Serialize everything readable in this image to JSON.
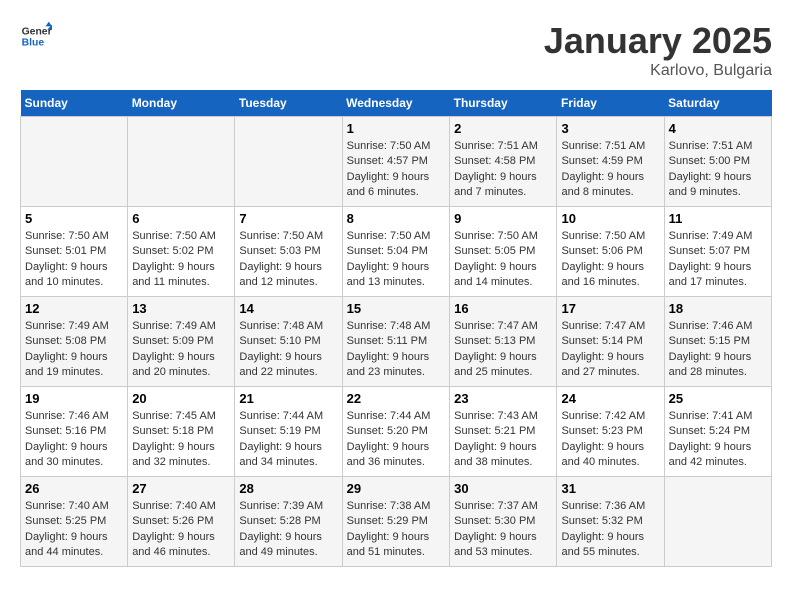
{
  "logo": {
    "general": "General",
    "blue": "Blue"
  },
  "header": {
    "month": "January 2025",
    "location": "Karlovo, Bulgaria"
  },
  "days_of_week": [
    "Sunday",
    "Monday",
    "Tuesday",
    "Wednesday",
    "Thursday",
    "Friday",
    "Saturday"
  ],
  "weeks": [
    [
      {
        "day": "",
        "info": ""
      },
      {
        "day": "",
        "info": ""
      },
      {
        "day": "",
        "info": ""
      },
      {
        "day": "1",
        "info": "Sunrise: 7:50 AM\nSunset: 4:57 PM\nDaylight: 9 hours and 6 minutes."
      },
      {
        "day": "2",
        "info": "Sunrise: 7:51 AM\nSunset: 4:58 PM\nDaylight: 9 hours and 7 minutes."
      },
      {
        "day": "3",
        "info": "Sunrise: 7:51 AM\nSunset: 4:59 PM\nDaylight: 9 hours and 8 minutes."
      },
      {
        "day": "4",
        "info": "Sunrise: 7:51 AM\nSunset: 5:00 PM\nDaylight: 9 hours and 9 minutes."
      }
    ],
    [
      {
        "day": "5",
        "info": "Sunrise: 7:50 AM\nSunset: 5:01 PM\nDaylight: 9 hours and 10 minutes."
      },
      {
        "day": "6",
        "info": "Sunrise: 7:50 AM\nSunset: 5:02 PM\nDaylight: 9 hours and 11 minutes."
      },
      {
        "day": "7",
        "info": "Sunrise: 7:50 AM\nSunset: 5:03 PM\nDaylight: 9 hours and 12 minutes."
      },
      {
        "day": "8",
        "info": "Sunrise: 7:50 AM\nSunset: 5:04 PM\nDaylight: 9 hours and 13 minutes."
      },
      {
        "day": "9",
        "info": "Sunrise: 7:50 AM\nSunset: 5:05 PM\nDaylight: 9 hours and 14 minutes."
      },
      {
        "day": "10",
        "info": "Sunrise: 7:50 AM\nSunset: 5:06 PM\nDaylight: 9 hours and 16 minutes."
      },
      {
        "day": "11",
        "info": "Sunrise: 7:49 AM\nSunset: 5:07 PM\nDaylight: 9 hours and 17 minutes."
      }
    ],
    [
      {
        "day": "12",
        "info": "Sunrise: 7:49 AM\nSunset: 5:08 PM\nDaylight: 9 hours and 19 minutes."
      },
      {
        "day": "13",
        "info": "Sunrise: 7:49 AM\nSunset: 5:09 PM\nDaylight: 9 hours and 20 minutes."
      },
      {
        "day": "14",
        "info": "Sunrise: 7:48 AM\nSunset: 5:10 PM\nDaylight: 9 hours and 22 minutes."
      },
      {
        "day": "15",
        "info": "Sunrise: 7:48 AM\nSunset: 5:11 PM\nDaylight: 9 hours and 23 minutes."
      },
      {
        "day": "16",
        "info": "Sunrise: 7:47 AM\nSunset: 5:13 PM\nDaylight: 9 hours and 25 minutes."
      },
      {
        "day": "17",
        "info": "Sunrise: 7:47 AM\nSunset: 5:14 PM\nDaylight: 9 hours and 27 minutes."
      },
      {
        "day": "18",
        "info": "Sunrise: 7:46 AM\nSunset: 5:15 PM\nDaylight: 9 hours and 28 minutes."
      }
    ],
    [
      {
        "day": "19",
        "info": "Sunrise: 7:46 AM\nSunset: 5:16 PM\nDaylight: 9 hours and 30 minutes."
      },
      {
        "day": "20",
        "info": "Sunrise: 7:45 AM\nSunset: 5:18 PM\nDaylight: 9 hours and 32 minutes."
      },
      {
        "day": "21",
        "info": "Sunrise: 7:44 AM\nSunset: 5:19 PM\nDaylight: 9 hours and 34 minutes."
      },
      {
        "day": "22",
        "info": "Sunrise: 7:44 AM\nSunset: 5:20 PM\nDaylight: 9 hours and 36 minutes."
      },
      {
        "day": "23",
        "info": "Sunrise: 7:43 AM\nSunset: 5:21 PM\nDaylight: 9 hours and 38 minutes."
      },
      {
        "day": "24",
        "info": "Sunrise: 7:42 AM\nSunset: 5:23 PM\nDaylight: 9 hours and 40 minutes."
      },
      {
        "day": "25",
        "info": "Sunrise: 7:41 AM\nSunset: 5:24 PM\nDaylight: 9 hours and 42 minutes."
      }
    ],
    [
      {
        "day": "26",
        "info": "Sunrise: 7:40 AM\nSunset: 5:25 PM\nDaylight: 9 hours and 44 minutes."
      },
      {
        "day": "27",
        "info": "Sunrise: 7:40 AM\nSunset: 5:26 PM\nDaylight: 9 hours and 46 minutes."
      },
      {
        "day": "28",
        "info": "Sunrise: 7:39 AM\nSunset: 5:28 PM\nDaylight: 9 hours and 49 minutes."
      },
      {
        "day": "29",
        "info": "Sunrise: 7:38 AM\nSunset: 5:29 PM\nDaylight: 9 hours and 51 minutes."
      },
      {
        "day": "30",
        "info": "Sunrise: 7:37 AM\nSunset: 5:30 PM\nDaylight: 9 hours and 53 minutes."
      },
      {
        "day": "31",
        "info": "Sunrise: 7:36 AM\nSunset: 5:32 PM\nDaylight: 9 hours and 55 minutes."
      },
      {
        "day": "",
        "info": ""
      }
    ]
  ]
}
